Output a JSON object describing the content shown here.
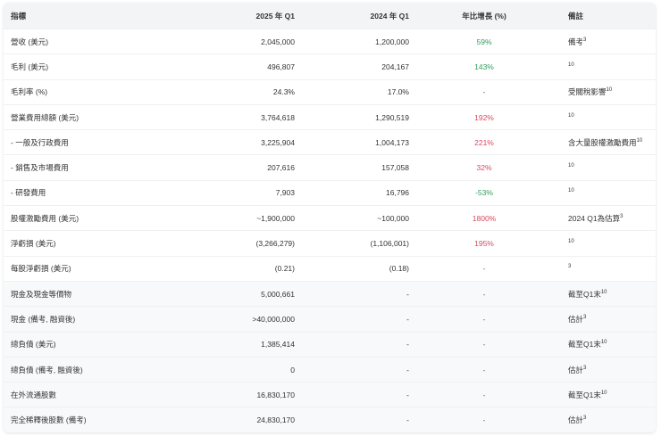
{
  "headers": [
    "指標",
    "2025 年 Q1",
    "2024 年 Q1",
    "年比增長 (%)",
    "備註"
  ],
  "colors": {
    "positive": "#2f9e5e",
    "negative": "#d9485f"
  },
  "rows": [
    {
      "metric": "營收 (美元)",
      "q1_2025": "2,045,000",
      "q1_2024": "1,200,000",
      "yoy": "59%",
      "yoy_tone": "pos",
      "note": "備考",
      "ref": "3"
    },
    {
      "metric": "毛利 (美元)",
      "q1_2025": "496,807",
      "q1_2024": "204,167",
      "yoy": "143%",
      "yoy_tone": "pos",
      "note": "",
      "ref": "10"
    },
    {
      "metric": "毛利率 (%)",
      "q1_2025": "24.3%",
      "q1_2024": "17.0%",
      "yoy": "-",
      "yoy_tone": "neu",
      "note": "受關稅影響",
      "ref": "10"
    },
    {
      "metric": "營業費用總額 (美元)",
      "q1_2025": "3,764,618",
      "q1_2024": "1,290,519",
      "yoy": "192%",
      "yoy_tone": "neg",
      "note": "",
      "ref": "10"
    },
    {
      "metric": "- 一般及行政費用",
      "q1_2025": "3,225,904",
      "q1_2024": "1,004,173",
      "yoy": "221%",
      "yoy_tone": "neg",
      "note": "含大量股權激勵費用",
      "ref": "10"
    },
    {
      "metric": "- 銷售及市場費用",
      "q1_2025": "207,616",
      "q1_2024": "157,058",
      "yoy": "32%",
      "yoy_tone": "neg",
      "note": "",
      "ref": "10"
    },
    {
      "metric": "- 研發費用",
      "q1_2025": "7,903",
      "q1_2024": "16,796",
      "yoy": "-53%",
      "yoy_tone": "pos",
      "note": "",
      "ref": "10"
    },
    {
      "metric": "股權激勵費用 (美元)",
      "q1_2025": "~1,900,000",
      "q1_2024": "~100,000",
      "yoy": "1800%",
      "yoy_tone": "neg",
      "note": "2024 Q1為估算",
      "ref": "3"
    },
    {
      "metric": "淨虧損 (美元)",
      "q1_2025": "(3,266,279)",
      "q1_2024": "(1,106,001)",
      "yoy": "195%",
      "yoy_tone": "neg",
      "note": "",
      "ref": "10"
    },
    {
      "metric": "每股淨虧損 (美元)",
      "q1_2025": "(0.21)",
      "q1_2024": "(0.18)",
      "yoy": "-",
      "yoy_tone": "neu",
      "note": "",
      "ref": "3"
    },
    {
      "metric": "現金及現金等價物",
      "q1_2025": "5,000,661",
      "q1_2024": "-",
      "yoy": "-",
      "yoy_tone": "neu",
      "note": "截至Q1末",
      "ref": "10"
    },
    {
      "metric": "現金 (備考, 融資後)",
      "q1_2025": ">40,000,000",
      "q1_2024": "-",
      "yoy": "-",
      "yoy_tone": "neu",
      "note": "估計",
      "ref": "3"
    },
    {
      "metric": "總負債 (美元)",
      "q1_2025": "1,385,414",
      "q1_2024": "-",
      "yoy": "-",
      "yoy_tone": "neu",
      "note": "截至Q1末",
      "ref": "10"
    },
    {
      "metric": "總負債 (備考, 融資後)",
      "q1_2025": "0",
      "q1_2024": "-",
      "yoy": "-",
      "yoy_tone": "neu",
      "note": "估計",
      "ref": "3"
    },
    {
      "metric": "在外流通股數",
      "q1_2025": "16,830,170",
      "q1_2024": "-",
      "yoy": "-",
      "yoy_tone": "neu",
      "note": "截至Q1末",
      "ref": "10"
    },
    {
      "metric": "完全稀釋後股數 (備考)",
      "q1_2025": "24,830,170",
      "q1_2024": "-",
      "yoy": "-",
      "yoy_tone": "neu",
      "note": "估計",
      "ref": "3"
    }
  ]
}
